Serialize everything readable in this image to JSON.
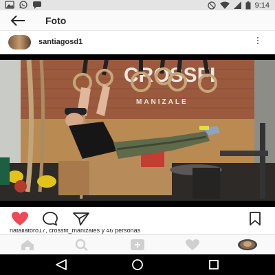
{
  "status_bar": {
    "time": "9:14",
    "left_icons": [
      "image-icon",
      "whatsapp-icon",
      "chat-icon"
    ],
    "right_icons": [
      "signal-off-icon",
      "wifi-icon",
      "cell-signal-icon",
      "battery-icon"
    ]
  },
  "app_bar": {
    "title": "Foto",
    "back_icon": "arrow-left-icon"
  },
  "post": {
    "username": "santiagosd1",
    "menu_icon": "more-vertical-icon",
    "photo_sign_line1": "CROSSFI",
    "photo_sign_line2": "MANIZALE",
    "liked": true,
    "likes_text": "nataliatoro17, crossfit_manizales y 46 personas"
  },
  "actions": {
    "like_icon": "heart-filled-icon",
    "comment_icon": "comment-icon",
    "share_icon": "send-icon",
    "save_icon": "bookmark-icon"
  },
  "bottom_nav": [
    "home-icon",
    "search-icon",
    "add-icon",
    "activity-heart-icon",
    "profile-avatar-icon"
  ],
  "android_nav": [
    "back-triangle-icon",
    "home-circle-icon",
    "recents-square-icon"
  ],
  "colors": {
    "like_red": "#ed4956",
    "status_bar": "#e4e4e4",
    "nav_bar": "#000000"
  }
}
